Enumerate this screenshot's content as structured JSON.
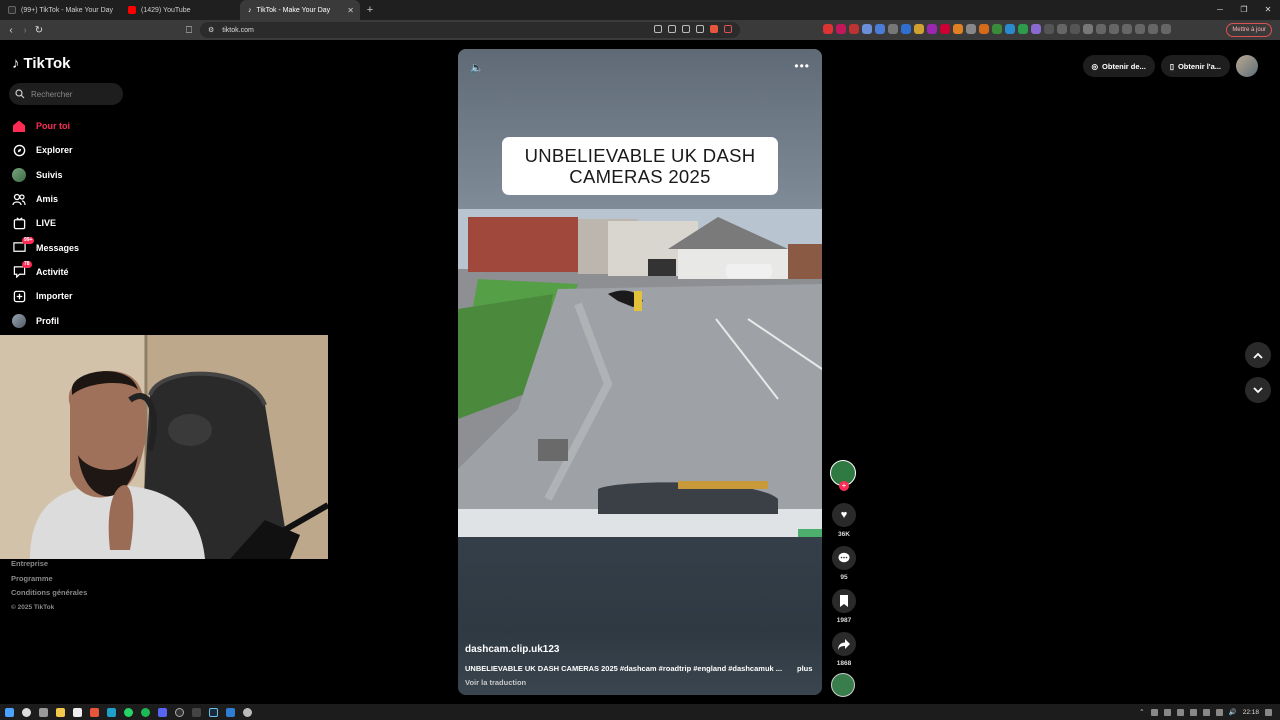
{
  "browser": {
    "tabs": [
      {
        "title": "(99+) TikTok - Make Your Day",
        "active": false,
        "favicon_color": "#2b2b2b"
      },
      {
        "title": "(1429) YouTube",
        "active": false,
        "favicon_color": "#ff0000"
      },
      {
        "title": "TikTok - Make Your Day",
        "active": true,
        "favicon_color": "#000000"
      }
    ],
    "new_tab": "+",
    "url": "tiktok.com",
    "update_button": "Mettre à jour",
    "clock": "22:18"
  },
  "sidebar": {
    "logo": "TikTok",
    "search_placeholder": "Rechercher",
    "items": [
      {
        "label": "Pour toi",
        "icon": "home-icon",
        "glyph": "⌂",
        "badge": ""
      },
      {
        "label": "Explorer",
        "icon": "compass-icon",
        "glyph": "◎",
        "badge": ""
      },
      {
        "label": "Suivis",
        "icon": "following-avatar-icon",
        "glyph": "",
        "badge": ""
      },
      {
        "label": "Amis",
        "icon": "friends-icon",
        "glyph": "👥",
        "badge": ""
      },
      {
        "label": "LIVE",
        "icon": "live-icon",
        "glyph": "▣",
        "badge": ""
      },
      {
        "label": "Messages",
        "icon": "messages-icon",
        "glyph": "✉",
        "badge": "99+"
      },
      {
        "label": "Activité",
        "icon": "activity-icon",
        "glyph": "☐",
        "badge": "78"
      },
      {
        "label": "Importer",
        "icon": "upload-icon",
        "glyph": "⊞",
        "badge": ""
      },
      {
        "label": "Profil",
        "icon": "profile-avatar-icon",
        "glyph": "",
        "badge": ""
      }
    ],
    "footer": {
      "links": [
        "Entreprise",
        "Programme",
        "Conditions générales"
      ],
      "copyright": "© 2025 TikTok"
    }
  },
  "video": {
    "overlay_title": "UNBELIEVABLE UK DASH CAMERAS 2025",
    "author": "dashcam.clip.uk123",
    "caption": "UNBELIEVABLE UK DASH CAMERAS 2025 #dashcam #roadtrip #england #dashcamuk ...",
    "more_label": "plus",
    "translate_label": "Voir la traduction"
  },
  "actions": {
    "likes": "36K",
    "comments": "95",
    "saves": "1987",
    "shares": "1868"
  },
  "top_right": {
    "btn1": "Obtenir de...",
    "btn2": "Obtenir l'a..."
  },
  "colors": {
    "accent": "#fe2c55",
    "background": "#000000"
  }
}
